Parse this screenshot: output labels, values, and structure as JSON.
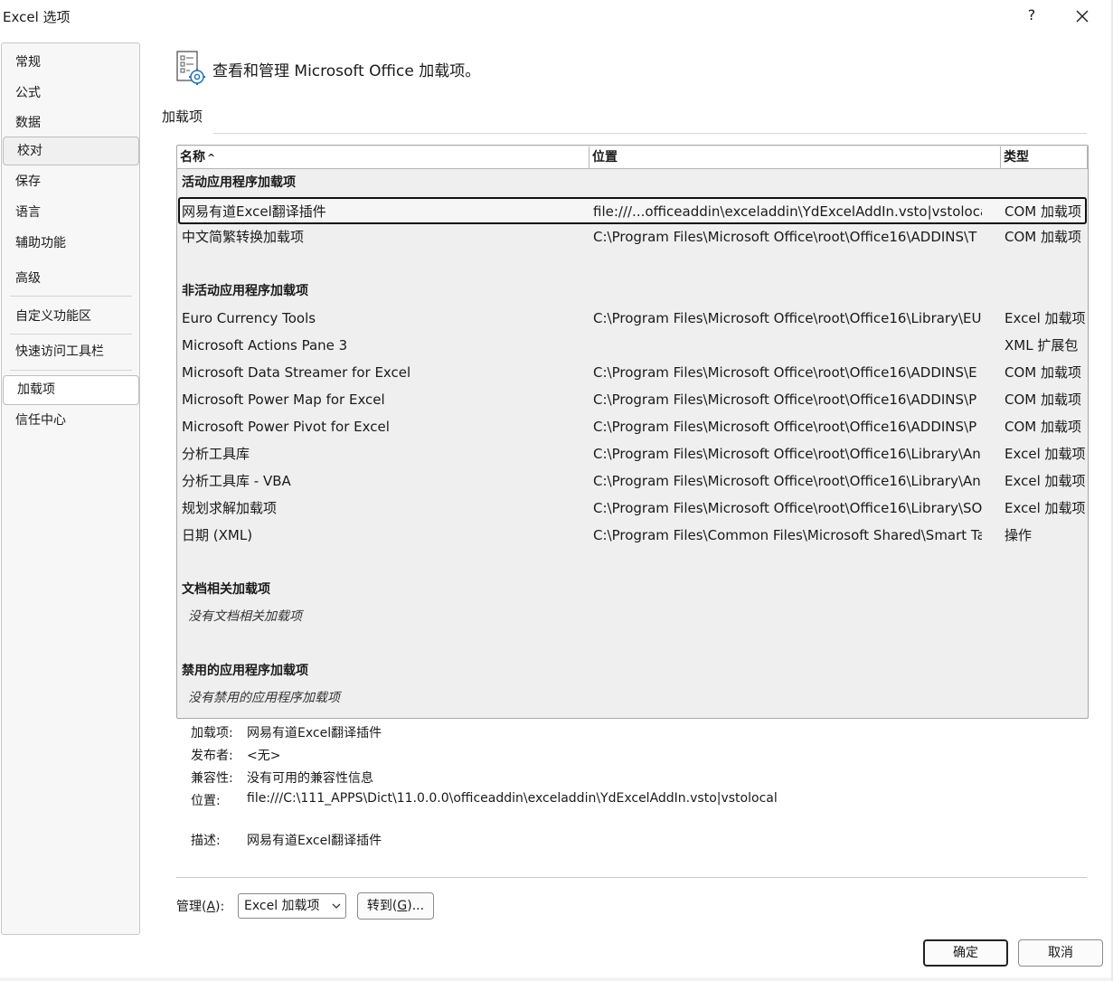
{
  "window": {
    "title": "Excel 选项",
    "help": "?",
    "close": "×"
  },
  "sidebar": {
    "items": [
      {
        "label": "常规"
      },
      {
        "label": "公式"
      },
      {
        "label": "数据"
      },
      {
        "label": "校对"
      },
      {
        "label": "保存"
      },
      {
        "label": "语言"
      },
      {
        "label": "辅助功能"
      },
      {
        "label": "高级"
      },
      {
        "label": "自定义功能区"
      },
      {
        "label": "快速访问工具栏"
      },
      {
        "label": "加载项",
        "selected": true
      },
      {
        "label": "信任中心"
      }
    ]
  },
  "header": {
    "icon": "addins-gear-icon",
    "text": "查看和管理 Microsoft Office 加载项。"
  },
  "section": {
    "title": "加载项"
  },
  "table": {
    "columns": {
      "name": "名称",
      "sort_indicator": "^",
      "location": "位置",
      "type": "类型"
    },
    "groups": {
      "active": {
        "title": "活动应用程序加载项",
        "rows": [
          {
            "name": "网易有道Excel翻译插件",
            "location": "file:///...officeaddin\\exceladdin\\YdExcelAddIn.vsto|vstolocal",
            "type": "COM 加载项"
          },
          {
            "name": "中文简繁转换加载项",
            "location": "C:\\Program Files\\Microsoft Office\\root\\Office16\\ADDINS\\T",
            "type": "COM 加载项"
          }
        ]
      },
      "inactive": {
        "title": "非活动应用程序加载项",
        "rows": [
          {
            "name": "Euro Currency Tools",
            "location": "C:\\Program Files\\Microsoft Office\\root\\Office16\\Library\\EU",
            "type": "Excel 加载项"
          },
          {
            "name": "Microsoft Actions Pane 3",
            "location": "",
            "type": "XML 扩展包"
          },
          {
            "name": "Microsoft Data Streamer for Excel",
            "location": "C:\\Program Files\\Microsoft Office\\root\\Office16\\ADDINS\\E",
            "type": "COM 加载项"
          },
          {
            "name": "Microsoft Power Map for Excel",
            "location": "C:\\Program Files\\Microsoft Office\\root\\Office16\\ADDINS\\P",
            "type": "COM 加载项"
          },
          {
            "name": "Microsoft Power Pivot for Excel",
            "location": "C:\\Program Files\\Microsoft Office\\root\\Office16\\ADDINS\\P",
            "type": "COM 加载项"
          },
          {
            "name": "分析工具库",
            "location": "C:\\Program Files\\Microsoft Office\\root\\Office16\\Library\\An",
            "type": "Excel 加载项"
          },
          {
            "name": "分析工具库 - VBA",
            "location": "C:\\Program Files\\Microsoft Office\\root\\Office16\\Library\\An",
            "type": "Excel 加载项"
          },
          {
            "name": "规划求解加载项",
            "location": "C:\\Program Files\\Microsoft Office\\root\\Office16\\Library\\SO",
            "type": "Excel 加载项"
          },
          {
            "name": "日期 (XML)",
            "location": "C:\\Program Files\\Common Files\\Microsoft Shared\\Smart Ta",
            "type": "操作"
          }
        ]
      },
      "document": {
        "title": "文档相关加载项",
        "empty": "没有文档相关加载项"
      },
      "disabled": {
        "title": "禁用的应用程序加载项",
        "empty": "没有禁用的应用程序加载项"
      }
    }
  },
  "details": {
    "addin": {
      "label": "加载项:",
      "value": "网易有道Excel翻译插件"
    },
    "publisher": {
      "label": "发布者:",
      "value": "<无>"
    },
    "compat": {
      "label": "兼容性:",
      "value": "没有可用的兼容性信息"
    },
    "location": {
      "label": "位置:",
      "value": "file:///C:\\111_APPS\\Dict\\11.0.0.0\\officeaddin\\exceladdin\\YdExcelAddIn.vsto|vstolocal"
    },
    "description": {
      "label": "描述:",
      "value": "网易有道Excel翻译插件"
    }
  },
  "manage": {
    "label_prefix": "管理(",
    "label_key": "A",
    "label_suffix": "):",
    "selected": "Excel 加载项",
    "go_prefix": "转到(",
    "go_key": "G",
    "go_suffix": ")..."
  },
  "footer": {
    "ok": "确定",
    "cancel": "取消"
  }
}
